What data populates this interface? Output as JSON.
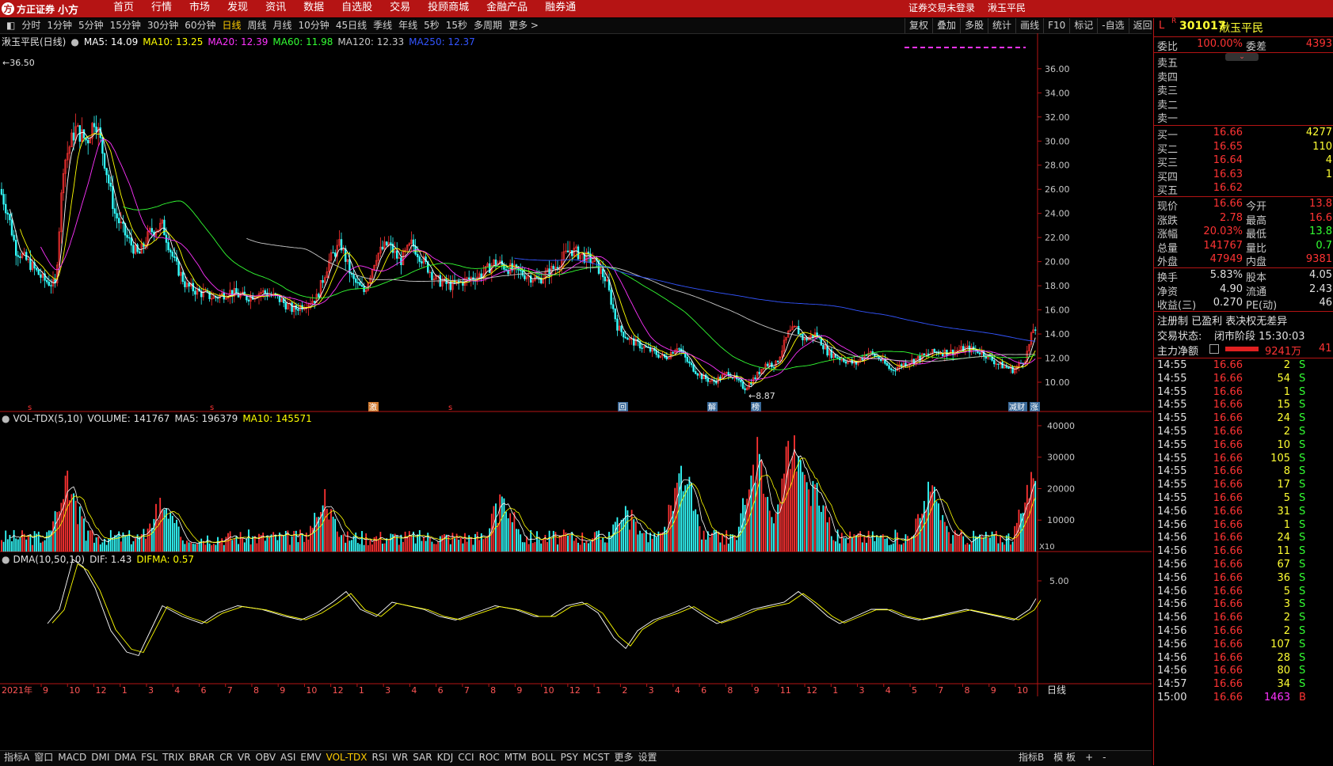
{
  "app": {
    "logo_text": "方正证券",
    "logo_sub": "小方",
    "menu": [
      "首页",
      "行情",
      "市场",
      "发现",
      "资讯",
      "数据",
      "自选股",
      "交易",
      "投顾商城",
      "金融产品",
      "融券通"
    ],
    "login_status": "证券交易未登录",
    "current_stock_name": "湫玉平民"
  },
  "periods": [
    "分时",
    "1分钟",
    "5分钟",
    "15分钟",
    "30分钟",
    "60分钟",
    "日线",
    "周线",
    "月线",
    "10分钟",
    "45日线",
    "季线",
    "年线",
    "5秒",
    "15秒",
    "多周期",
    "更多 >"
  ],
  "active_period": "日线",
  "tools": [
    "复权",
    "叠加",
    "多股",
    "统计",
    "画线",
    "F10",
    "标记",
    "-自选",
    "返回"
  ],
  "main_chart": {
    "title": "湫玉平民(日线)",
    "ma": [
      {
        "label": "MA5: 14.09",
        "color": "#ffffff"
      },
      {
        "label": "MA10: 13.25",
        "color": "#ffff00"
      },
      {
        "label": "MA20: 12.39",
        "color": "#ff33ff"
      },
      {
        "label": "MA60: 11.98",
        "color": "#33ff33"
      },
      {
        "label": "MA120: 12.33",
        "color": "#c8c8c8"
      },
      {
        "label": "MA250: 12.37",
        "color": "#3355ff"
      }
    ],
    "high_marker": "36.50",
    "low_marker": "8.87",
    "y_ticks": [
      "36.00",
      "34.00",
      "32.00",
      "30.00",
      "28.00",
      "26.00",
      "24.00",
      "22.00",
      "20.00",
      "18.00",
      "16.00",
      "14.00",
      "12.00",
      "10.00"
    ],
    "event_tags": [
      "激",
      "回",
      "解",
      "榜",
      "减财",
      "涨"
    ]
  },
  "volume_chart": {
    "title": "VOL-TDX(5,10)",
    "volume": "VOLUME: 141767",
    "ma5": "MA5: 196379",
    "ma10": "MA10: 145571",
    "y_ticks": [
      "40000",
      "30000",
      "20000",
      "10000"
    ],
    "unit": "X10"
  },
  "dma_chart": {
    "title": "DMA(10,50,10)",
    "dif": "DIF: 1.43",
    "difma": "DIFMA: 0.57",
    "y_tick": "5.00"
  },
  "x_axis": {
    "year_label": "2021年",
    "months": [
      "9",
      "10",
      "12",
      "1",
      "3",
      "4",
      "6",
      "7",
      "8",
      "9",
      "10",
      "12",
      "1",
      "3",
      "4",
      "6",
      "7",
      "8",
      "9",
      "10",
      "12",
      "1",
      "2",
      "3",
      "4",
      "6",
      "8",
      "9",
      "11",
      "12",
      "1",
      "3",
      "4",
      "5",
      "7",
      "8",
      "9",
      "10"
    ],
    "period_label": "日线"
  },
  "quote": {
    "code": "301017",
    "name": "湫玉平民",
    "flag_l": "L",
    "flag_r": "R",
    "weibi_label": "委比",
    "weibi": "100.00%",
    "weicha_label": "委差",
    "weicha": "4393",
    "sell": [
      "卖五",
      "卖四",
      "卖三",
      "卖二",
      "卖一"
    ],
    "buy": [
      {
        "label": "买一",
        "price": "16.66",
        "vol": "4277"
      },
      {
        "label": "买二",
        "price": "16.65",
        "vol": "110"
      },
      {
        "label": "买三",
        "price": "16.64",
        "vol": "4"
      },
      {
        "label": "买四",
        "price": "16.63",
        "vol": "1"
      },
      {
        "label": "买五",
        "price": "16.62",
        "vol": ""
      }
    ],
    "stats": [
      {
        "l1": "现价",
        "v1": "16.66",
        "l2": "今开",
        "v2": "13.8"
      },
      {
        "l1": "涨跌",
        "v1": "2.78",
        "l2": "最高",
        "v2": "16.6"
      },
      {
        "l1": "涨幅",
        "v1": "20.03%",
        "l2": "最低",
        "v2": "13.8"
      },
      {
        "l1": "总量",
        "v1": "141767",
        "l2": "量比",
        "v2": "0.7"
      },
      {
        "l1": "外盘",
        "v1": "47949",
        "l2": "内盘",
        "v2": "9381"
      }
    ],
    "fin": [
      {
        "l1": "换手",
        "v1": "5.83%",
        "l2": "股本",
        "v2": "4.05"
      },
      {
        "l1": "净资",
        "v1": "4.90",
        "l2": "流通",
        "v2": "2.43"
      },
      {
        "l1": "收益(三)",
        "v1": "0.270",
        "l2": "PE(动)",
        "v2": "46"
      }
    ],
    "note": "注册制 已盈利 表决权无差异",
    "trade_status_label": "交易状态:",
    "trade_status": "闭市阶段 15:30:03",
    "main_net_label": "主力净额",
    "main_net": "9241万",
    "main_net_extra": "41",
    "ticks": [
      {
        "t": "14:55",
        "p": "16.66",
        "v": "2",
        "s": "S"
      },
      {
        "t": "14:55",
        "p": "16.66",
        "v": "54",
        "s": "S"
      },
      {
        "t": "14:55",
        "p": "16.66",
        "v": "1",
        "s": "S"
      },
      {
        "t": "14:55",
        "p": "16.66",
        "v": "15",
        "s": "S"
      },
      {
        "t": "14:55",
        "p": "16.66",
        "v": "24",
        "s": "S"
      },
      {
        "t": "14:55",
        "p": "16.66",
        "v": "2",
        "s": "S"
      },
      {
        "t": "14:55",
        "p": "16.66",
        "v": "10",
        "s": "S"
      },
      {
        "t": "14:55",
        "p": "16.66",
        "v": "105",
        "s": "S"
      },
      {
        "t": "14:55",
        "p": "16.66",
        "v": "8",
        "s": "S"
      },
      {
        "t": "14:55",
        "p": "16.66",
        "v": "17",
        "s": "S"
      },
      {
        "t": "14:55",
        "p": "16.66",
        "v": "5",
        "s": "S"
      },
      {
        "t": "14:56",
        "p": "16.66",
        "v": "31",
        "s": "S"
      },
      {
        "t": "14:56",
        "p": "16.66",
        "v": "1",
        "s": "S"
      },
      {
        "t": "14:56",
        "p": "16.66",
        "v": "24",
        "s": "S"
      },
      {
        "t": "14:56",
        "p": "16.66",
        "v": "11",
        "s": "S"
      },
      {
        "t": "14:56",
        "p": "16.66",
        "v": "67",
        "s": "S"
      },
      {
        "t": "14:56",
        "p": "16.66",
        "v": "36",
        "s": "S"
      },
      {
        "t": "14:56",
        "p": "16.66",
        "v": "5",
        "s": "S"
      },
      {
        "t": "14:56",
        "p": "16.66",
        "v": "3",
        "s": "S"
      },
      {
        "t": "14:56",
        "p": "16.66",
        "v": "2",
        "s": "S"
      },
      {
        "t": "14:56",
        "p": "16.66",
        "v": "2",
        "s": "S"
      },
      {
        "t": "14:56",
        "p": "16.66",
        "v": "107",
        "s": "S"
      },
      {
        "t": "14:56",
        "p": "16.66",
        "v": "28",
        "s": "S"
      },
      {
        "t": "14:56",
        "p": "16.66",
        "v": "80",
        "s": "S"
      },
      {
        "t": "14:57",
        "p": "16.66",
        "v": "34",
        "s": "S"
      },
      {
        "t": "15:00",
        "p": "16.66",
        "v": "1463",
        "s": "B"
      }
    ]
  },
  "bottom_tabs": [
    "指标A",
    "窗口",
    "MACD",
    "DMI",
    "DMA",
    "FSL",
    "TRIX",
    "BRAR",
    "CR",
    "VR",
    "OBV",
    "ASI",
    "EMV",
    "VOL-TDX",
    "RSI",
    "WR",
    "SAR",
    "KDJ",
    "CCI",
    "ROC",
    "MTM",
    "BOLL",
    "PSY",
    "MCST",
    "更多",
    "设置"
  ],
  "active_tab": "VOL-TDX",
  "bottom_right": [
    "指标B",
    "模 板",
    "+",
    "-"
  ],
  "colors": {
    "up": "#ff3333",
    "down": "#33ffff",
    "frame": "#b51414",
    "ma5": "#ffffff",
    "ma10": "#ffff00",
    "ma20": "#ff33ff",
    "ma60": "#33ff33",
    "ma120": "#c8c8c8",
    "ma250": "#3355ff"
  }
}
